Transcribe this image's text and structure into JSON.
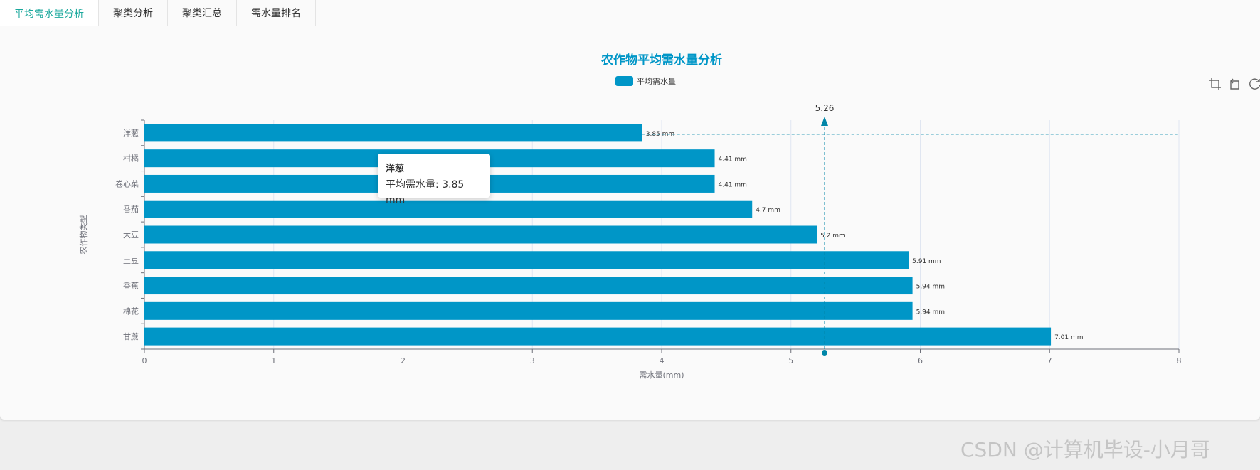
{
  "tabs": [
    {
      "label": "平均需水量分析",
      "active": true
    },
    {
      "label": "聚类分析",
      "active": false
    },
    {
      "label": "聚类汇总",
      "active": false
    },
    {
      "label": "需水量排名",
      "active": false
    }
  ],
  "toolbox": [
    "zoom-in-icon",
    "zoom-reset-icon",
    "restore-icon"
  ],
  "chart_data": {
    "type": "bar",
    "orientation": "horizontal",
    "title": "农作物平均需水量分析",
    "legend": {
      "entries": [
        "平均需水量"
      ],
      "placement": "top-center"
    },
    "categories": [
      "洋葱",
      "柑橘",
      "卷心菜",
      "番茄",
      "大豆",
      "土豆",
      "香蕉",
      "棉花",
      "甘蔗"
    ],
    "series": [
      {
        "name": "平均需水量",
        "values": [
          3.85,
          4.41,
          4.41,
          4.7,
          5.2,
          5.91,
          5.94,
          5.94,
          7.01
        ],
        "color": "#0096c7"
      }
    ],
    "data_labels": [
      "3.85 mm",
      "4.41 mm",
      "4.41 mm",
      "4.7 mm",
      "5.2 mm",
      "5.91 mm",
      "5.94 mm",
      "5.94 mm",
      "7.01 mm"
    ],
    "xlabel": "需水量(mm)",
    "ylabel": "农作物类型",
    "xlim": [
      0,
      8
    ],
    "xticks": [
      "0",
      "1",
      "2",
      "3",
      "4",
      "5",
      "6",
      "7",
      "8"
    ],
    "grid": "vertical",
    "average_line": {
      "value": 5.26,
      "label": "5.26"
    },
    "crosshair_category": "洋葱"
  },
  "tooltip": {
    "title": "洋葱",
    "line": "平均需水量: 3.85 mm"
  },
  "watermark": "CSDN @计算机毕设-小月哥",
  "colors": {
    "accent": "#1aa89c",
    "bar": "#0096c7",
    "title": "#0096c7"
  }
}
